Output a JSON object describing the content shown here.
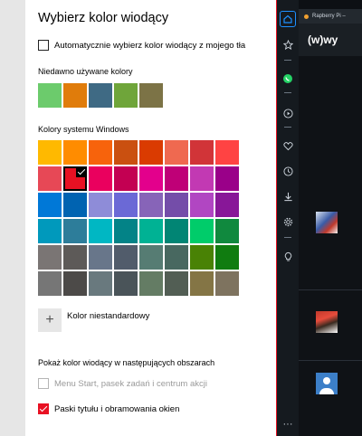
{
  "settings": {
    "title": "Wybierz kolor wiodący",
    "auto_checkbox_label": "Automatycznie wybierz kolor wiodący z mojego tła",
    "recent_label": "Niedawno używane kolory",
    "recent_colors": [
      "#6ccb6c",
      "#e07c0b",
      "#3f6a84",
      "#6fa53a",
      "#7c7346"
    ],
    "windows_label": "Kolory systemu Windows",
    "windows_colors": [
      [
        "#ffb900",
        "#ff8c00",
        "#f7630c",
        "#ca5010",
        "#da3b01",
        "#ef6950",
        "#d13438",
        "#ff4343"
      ],
      [
        "#e74856",
        "#e81123",
        "#ea005e",
        "#c30052",
        "#e3008c",
        "#bf0077",
        "#c239b3",
        "#9a0089"
      ],
      [
        "#0078d7",
        "#0063b1",
        "#8e8cd8",
        "#6b69d6",
        "#8764b8",
        "#744da9",
        "#b146c2",
        "#881798"
      ],
      [
        "#0099bc",
        "#2d7d9a",
        "#00b7c3",
        "#038387",
        "#00b294",
        "#018574",
        "#00cc6a",
        "#10893e"
      ],
      [
        "#7a7574",
        "#5d5a58",
        "#68768a",
        "#515c6b",
        "#567c73",
        "#486860",
        "#498205",
        "#107c10"
      ],
      [
        "#767676",
        "#4c4a48",
        "#69797e",
        "#4a5459",
        "#647c64",
        "#525e54",
        "#847545",
        "#7e735f"
      ]
    ],
    "selected_color": "#e81123",
    "custom_plus": "+",
    "custom_label": "Kolor niestandardowy",
    "show_label": "Pokaż kolor wiodący w następujących obszarach",
    "start_checkbox_label": "Menu Start, pasek zadań i centrum akcji",
    "title_bars_checkbox_label": "Paski tytułu i obramowania okien"
  },
  "browser": {
    "tab_title": "Rapberry Pi –",
    "logo_text": "(w)wy",
    "sidebar_icons": [
      "home-icon",
      "star-icon",
      "whatsapp-icon",
      "play-icon",
      "heart-icon",
      "clock-icon",
      "download-icon",
      "gear-icon",
      "lightbulb-icon",
      "more-icon"
    ],
    "more_glyph": "···"
  },
  "accent_color": "#e81123"
}
